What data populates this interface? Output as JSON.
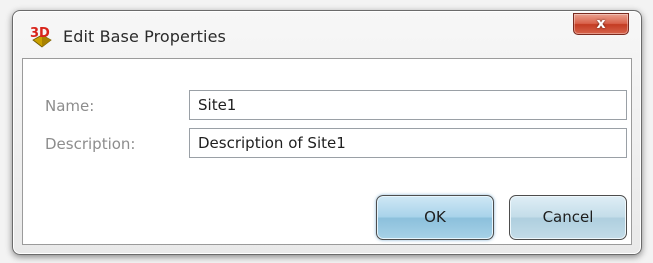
{
  "dialog": {
    "title": "Edit Base Properties",
    "app_icon_text": "3D",
    "close_label": "x"
  },
  "form": {
    "name_label": "Name:",
    "name_value": "Site1",
    "description_label": "Description:",
    "description_value": "Description of Site1"
  },
  "buttons": {
    "ok_label": "OK",
    "cancel_label": "Cancel"
  },
  "icons": {
    "app": "3d-app-icon",
    "close": "close-icon"
  }
}
